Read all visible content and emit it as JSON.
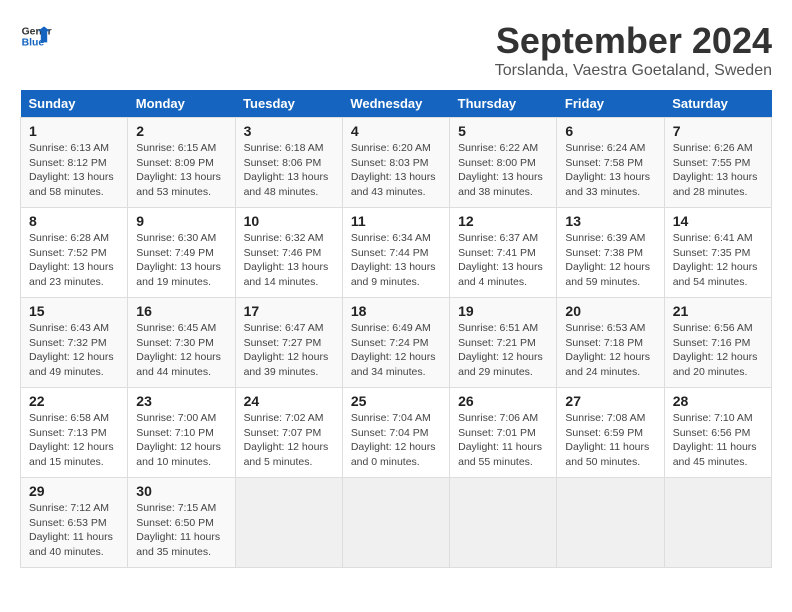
{
  "header": {
    "logo_line1": "General",
    "logo_line2": "Blue",
    "month_year": "September 2024",
    "location": "Torslanda, Vaestra Goetaland, Sweden"
  },
  "calendar": {
    "days_of_week": [
      "Sunday",
      "Monday",
      "Tuesday",
      "Wednesday",
      "Thursday",
      "Friday",
      "Saturday"
    ],
    "weeks": [
      [
        {
          "day": "",
          "info": ""
        },
        {
          "day": "2",
          "info": "Sunrise: 6:15 AM\nSunset: 8:09 PM\nDaylight: 13 hours\nand 53 minutes."
        },
        {
          "day": "3",
          "info": "Sunrise: 6:18 AM\nSunset: 8:06 PM\nDaylight: 13 hours\nand 48 minutes."
        },
        {
          "day": "4",
          "info": "Sunrise: 6:20 AM\nSunset: 8:03 PM\nDaylight: 13 hours\nand 43 minutes."
        },
        {
          "day": "5",
          "info": "Sunrise: 6:22 AM\nSunset: 8:00 PM\nDaylight: 13 hours\nand 38 minutes."
        },
        {
          "day": "6",
          "info": "Sunrise: 6:24 AM\nSunset: 7:58 PM\nDaylight: 13 hours\nand 33 minutes."
        },
        {
          "day": "7",
          "info": "Sunrise: 6:26 AM\nSunset: 7:55 PM\nDaylight: 13 hours\nand 28 minutes."
        }
      ],
      [
        {
          "day": "8",
          "info": "Sunrise: 6:28 AM\nSunset: 7:52 PM\nDaylight: 13 hours\nand 23 minutes."
        },
        {
          "day": "9",
          "info": "Sunrise: 6:30 AM\nSunset: 7:49 PM\nDaylight: 13 hours\nand 19 minutes."
        },
        {
          "day": "10",
          "info": "Sunrise: 6:32 AM\nSunset: 7:46 PM\nDaylight: 13 hours\nand 14 minutes."
        },
        {
          "day": "11",
          "info": "Sunrise: 6:34 AM\nSunset: 7:44 PM\nDaylight: 13 hours\nand 9 minutes."
        },
        {
          "day": "12",
          "info": "Sunrise: 6:37 AM\nSunset: 7:41 PM\nDaylight: 13 hours\nand 4 minutes."
        },
        {
          "day": "13",
          "info": "Sunrise: 6:39 AM\nSunset: 7:38 PM\nDaylight: 12 hours\nand 59 minutes."
        },
        {
          "day": "14",
          "info": "Sunrise: 6:41 AM\nSunset: 7:35 PM\nDaylight: 12 hours\nand 54 minutes."
        }
      ],
      [
        {
          "day": "15",
          "info": "Sunrise: 6:43 AM\nSunset: 7:32 PM\nDaylight: 12 hours\nand 49 minutes."
        },
        {
          "day": "16",
          "info": "Sunrise: 6:45 AM\nSunset: 7:30 PM\nDaylight: 12 hours\nand 44 minutes."
        },
        {
          "day": "17",
          "info": "Sunrise: 6:47 AM\nSunset: 7:27 PM\nDaylight: 12 hours\nand 39 minutes."
        },
        {
          "day": "18",
          "info": "Sunrise: 6:49 AM\nSunset: 7:24 PM\nDaylight: 12 hours\nand 34 minutes."
        },
        {
          "day": "19",
          "info": "Sunrise: 6:51 AM\nSunset: 7:21 PM\nDaylight: 12 hours\nand 29 minutes."
        },
        {
          "day": "20",
          "info": "Sunrise: 6:53 AM\nSunset: 7:18 PM\nDaylight: 12 hours\nand 24 minutes."
        },
        {
          "day": "21",
          "info": "Sunrise: 6:56 AM\nSunset: 7:16 PM\nDaylight: 12 hours\nand 20 minutes."
        }
      ],
      [
        {
          "day": "22",
          "info": "Sunrise: 6:58 AM\nSunset: 7:13 PM\nDaylight: 12 hours\nand 15 minutes."
        },
        {
          "day": "23",
          "info": "Sunrise: 7:00 AM\nSunset: 7:10 PM\nDaylight: 12 hours\nand 10 minutes."
        },
        {
          "day": "24",
          "info": "Sunrise: 7:02 AM\nSunset: 7:07 PM\nDaylight: 12 hours\nand 5 minutes."
        },
        {
          "day": "25",
          "info": "Sunrise: 7:04 AM\nSunset: 7:04 PM\nDaylight: 12 hours\nand 0 minutes."
        },
        {
          "day": "26",
          "info": "Sunrise: 7:06 AM\nSunset: 7:01 PM\nDaylight: 11 hours\nand 55 minutes."
        },
        {
          "day": "27",
          "info": "Sunrise: 7:08 AM\nSunset: 6:59 PM\nDaylight: 11 hours\nand 50 minutes."
        },
        {
          "day": "28",
          "info": "Sunrise: 7:10 AM\nSunset: 6:56 PM\nDaylight: 11 hours\nand 45 minutes."
        }
      ],
      [
        {
          "day": "29",
          "info": "Sunrise: 7:12 AM\nSunset: 6:53 PM\nDaylight: 11 hours\nand 40 minutes."
        },
        {
          "day": "30",
          "info": "Sunrise: 7:15 AM\nSunset: 6:50 PM\nDaylight: 11 hours\nand 35 minutes."
        },
        {
          "day": "",
          "info": ""
        },
        {
          "day": "",
          "info": ""
        },
        {
          "day": "",
          "info": ""
        },
        {
          "day": "",
          "info": ""
        },
        {
          "day": "",
          "info": ""
        }
      ]
    ],
    "week0_day1": {
      "day": "1",
      "info": "Sunrise: 6:13 AM\nSunset: 8:12 PM\nDaylight: 13 hours\nand 58 minutes."
    }
  }
}
